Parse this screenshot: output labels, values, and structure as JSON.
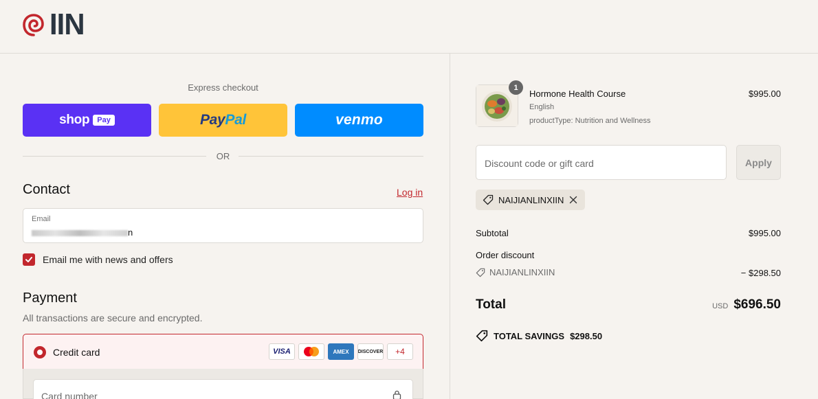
{
  "header": {
    "logo_text": "IIN"
  },
  "express": {
    "title": "Express checkout",
    "shop_word": "shop",
    "shop_pay": "Pay",
    "paypal_1": "Pay",
    "paypal_2": "Pal",
    "venmo": "venmo",
    "or": "OR"
  },
  "contact": {
    "heading": "Contact",
    "login": "Log in",
    "email_label": "Email",
    "email_value_end": "n",
    "marketing_label": "Email me with news and offers",
    "marketing_checked": true
  },
  "payment": {
    "heading": "Payment",
    "subtitle": "All transactions are secure and encrypted.",
    "method_label": "Credit card",
    "card_brands": [
      "VISA",
      "AMEX",
      "DISCOVER"
    ],
    "more_brands": "+4",
    "card_number_placeholder": "Card number"
  },
  "summary": {
    "item": {
      "name": "Hormone Health Course",
      "meta1": "English",
      "meta2": "productType: Nutrition and Wellness",
      "price": "$995.00",
      "quantity": "1"
    },
    "discount_placeholder": "Discount code or gift card",
    "apply_label": "Apply",
    "applied_code": "NAIJIANLINXIIN",
    "subtotal_label": "Subtotal",
    "subtotal_value": "$995.00",
    "order_discount_label": "Order discount",
    "order_discount_code": "NAIJIANLINXIIN",
    "order_discount_value": "− $298.50",
    "total_label": "Total",
    "currency": "USD",
    "total_value": "$696.50",
    "savings_label": "TOTAL SAVINGS",
    "savings_value": "$298.50"
  },
  "colors": {
    "accent": "#c2272d",
    "shop_pay": "#5a31f4",
    "paypal": "#ffc439",
    "venmo": "#008cff",
    "background": "#f6f3ef"
  }
}
